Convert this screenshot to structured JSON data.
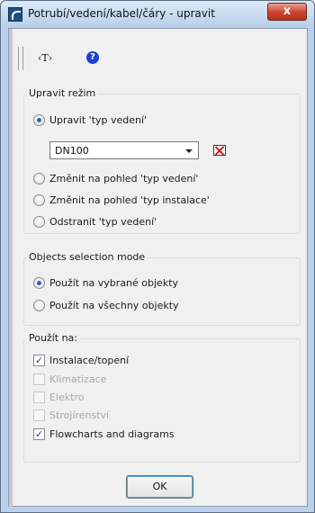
{
  "window": {
    "title": "Potrubí/vedení/kabel/čáry - upravit",
    "close_label": "x"
  },
  "toolbar": {
    "text_tool": "‹T›",
    "help_icon": "?"
  },
  "mode_group": {
    "title": "Upravit režim",
    "options": [
      {
        "label": "Upravit 'typ vedení'",
        "checked": true
      },
      {
        "label": "Změnit na pohled 'typ vedení'",
        "checked": false
      },
      {
        "label": "Změnit na pohled 'typ instalace'",
        "checked": false
      },
      {
        "label": "Odstranit 'typ vedení'",
        "checked": false
      }
    ],
    "combo_value": "DN100"
  },
  "selection_group": {
    "title": "Objects selection mode",
    "options": [
      {
        "label": "Použít na vybrané objekty",
        "checked": true
      },
      {
        "label": "Použít na všechny objekty",
        "checked": false
      }
    ]
  },
  "apply_group": {
    "title": "Použít na:",
    "items": [
      {
        "label": "Instalace/topení",
        "checked": true,
        "enabled": true
      },
      {
        "label": "Klimatizace",
        "checked": false,
        "enabled": false
      },
      {
        "label": "Elektro",
        "checked": false,
        "enabled": false
      },
      {
        "label": "Strojírenství",
        "checked": false,
        "enabled": false
      },
      {
        "label": "Flowcharts and diagrams",
        "checked": true,
        "enabled": true
      }
    ]
  },
  "buttons": {
    "ok_label": "OK"
  }
}
